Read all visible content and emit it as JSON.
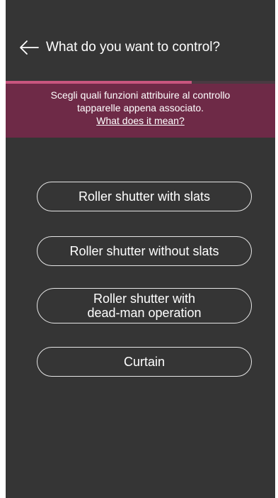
{
  "header": {
    "title": "What do you want to control?",
    "back_icon": "arrow-left-icon"
  },
  "progress": {
    "fraction": 0.69
  },
  "info": {
    "line1": "Scegli quali funzioni attribuire al controllo",
    "line2": "tapparelle appena associato.",
    "link": "What does it mean?"
  },
  "options": [
    {
      "label": "Roller shutter with slats"
    },
    {
      "label": "Roller shutter without slats"
    },
    {
      "line1": "Roller shutter with",
      "line2": "dead-man operation"
    },
    {
      "label": "Curtain"
    }
  ],
  "colors": {
    "background": "#353535",
    "banner": "#6e2a47",
    "progress": "#c9557f",
    "text": "#ffffff"
  }
}
